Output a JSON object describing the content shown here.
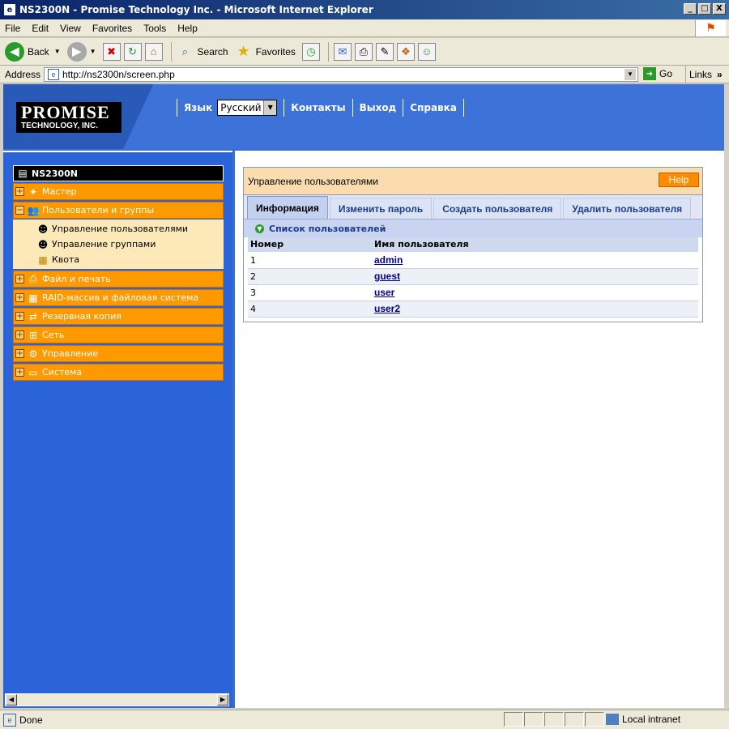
{
  "window": {
    "title": "NS2300N - Promise Technology Inc. - Microsoft Internet Explorer",
    "minimize": "_",
    "maximize": "□",
    "close": "X"
  },
  "menu": [
    "File",
    "Edit",
    "View",
    "Favorites",
    "Tools",
    "Help"
  ],
  "toolbar": {
    "back": "Back",
    "search": "Search",
    "favorites": "Favorites"
  },
  "address": {
    "label": "Address",
    "url": "http://ns2300n/screen.php",
    "go": "Go",
    "links": "Links"
  },
  "header": {
    "logo_line1": "PROMISE",
    "logo_line2": "TECHNOLOGY, INC.",
    "lang_label": "Язык",
    "lang_value": "Русский",
    "nav": [
      "Контакты",
      "Выход",
      "Справка"
    ]
  },
  "sidebar": {
    "root": "NS2300N",
    "items": [
      {
        "label": "Мастер",
        "icon": "wizard-icon"
      },
      {
        "label": "Пользователи и группы",
        "icon": "users-groups-icon",
        "expanded": true,
        "children": [
          {
            "label": "Управление пользователями",
            "icon": "user-icon"
          },
          {
            "label": "Управление группами",
            "icon": "group-icon"
          },
          {
            "label": "Квота",
            "icon": "quota-icon"
          }
        ]
      },
      {
        "label": "Файл и печать",
        "icon": "printer-icon"
      },
      {
        "label": "RAID-массив и файловая система",
        "icon": "raid-icon"
      },
      {
        "label": "Резервная копия",
        "icon": "backup-icon"
      },
      {
        "label": "Сеть",
        "icon": "network-icon"
      },
      {
        "label": "Управление",
        "icon": "management-icon"
      },
      {
        "label": "Система",
        "icon": "monitor-icon"
      }
    ]
  },
  "panel": {
    "title": "Управление пользователями",
    "help": "Help",
    "tabs": [
      "Информация",
      "Изменить пароль",
      "Создать пользователя",
      "Удалить пользователя"
    ],
    "active_tab": 0,
    "list_title": "Список пользователей",
    "columns": [
      "Номер",
      "Имя пользователя"
    ],
    "rows": [
      {
        "num": "1",
        "name": "admin"
      },
      {
        "num": "2",
        "name": "guest"
      },
      {
        "num": "3",
        "name": "user"
      },
      {
        "num": "4",
        "name": "user2"
      }
    ]
  },
  "status": {
    "text": "Done",
    "zone": "Local intranet"
  },
  "colors": {
    "accent": "#ff9900",
    "header_blue": "#3366cc",
    "sidebar_blue": "#2b63d8"
  }
}
